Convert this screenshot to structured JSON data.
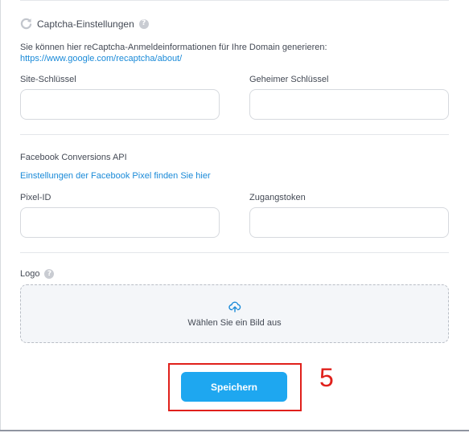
{
  "captcha": {
    "title": "Captcha-Einstellungen",
    "help": "?",
    "description": "Sie können hier reCaptcha-Anmeldeinformationen für Ihre Domain generieren:",
    "link": "https://www.google.com/recaptcha/about/",
    "site_key_label": "Site-Schlüssel",
    "site_key_value": "",
    "secret_key_label": "Geheimer Schlüssel",
    "secret_key_value": ""
  },
  "facebook": {
    "title": "Facebook Conversions API",
    "pixel_link": "Einstellungen der Facebook Pixel finden Sie hier",
    "pixel_id_label": "Pixel-ID",
    "pixel_id_value": "",
    "token_label": "Zugangstoken",
    "token_value": ""
  },
  "logo": {
    "label": "Logo",
    "help": "?",
    "upload_text": "Wählen Sie ein Bild aus"
  },
  "save_button": "Speichern",
  "annotation_number": "5",
  "colors": {
    "accent": "#1ea7f0",
    "link": "#1a8ad8",
    "highlight": "#e0201b"
  },
  "icons": {
    "captcha": "refresh-icon",
    "help": "help-icon",
    "upload": "cloud-upload-icon"
  }
}
